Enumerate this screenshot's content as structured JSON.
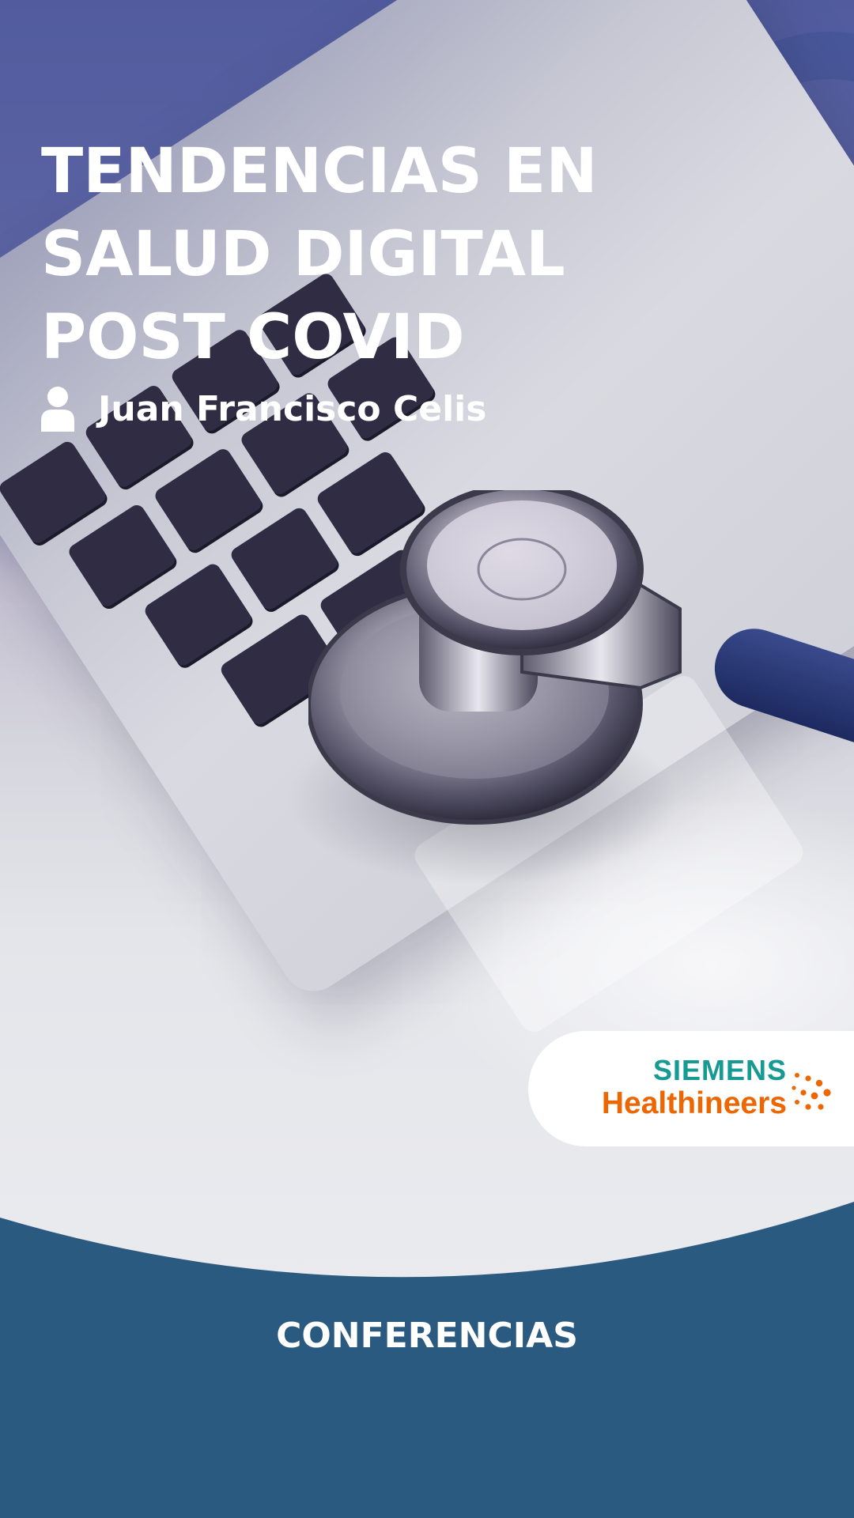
{
  "title": "TENDENCIAS EN\nSALUD DIGITAL\nPOST COVID",
  "author": {
    "icon": "person-icon",
    "name": "Juan Francisco Celis"
  },
  "logo": {
    "line1": "SIEMENS",
    "line2": "Healthineers",
    "colors": {
      "siemens": "#169a94",
      "healthineers": "#ec6602"
    }
  },
  "footer": {
    "label": "CONFERENCIAS",
    "background": "#2b5a80"
  },
  "background_image": "stethoscope-on-laptop-photo"
}
